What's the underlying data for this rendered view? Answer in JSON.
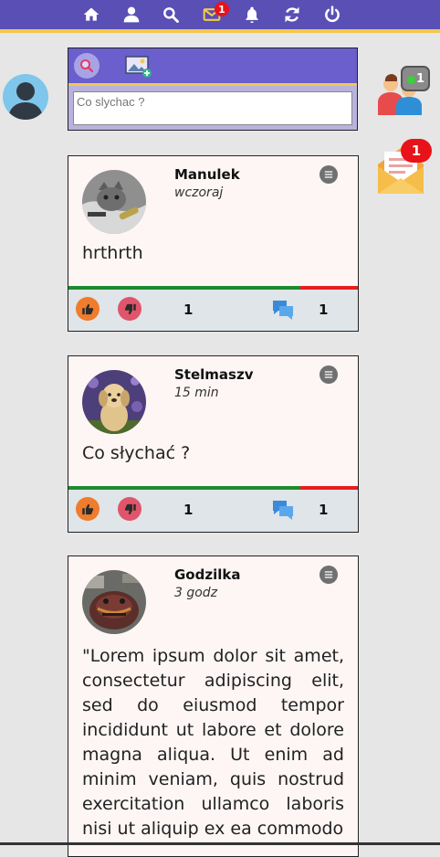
{
  "nav": {
    "message_badge": "1"
  },
  "composer": {
    "placeholder": "Co slychac ?"
  },
  "sidebar": {
    "online_users_count": "1",
    "mail_badge": "1"
  },
  "posts": [
    {
      "author": "Manulek",
      "time": "wczoraj",
      "text": "hrthrth",
      "likes": "1",
      "comments": "1",
      "approval": 0.8
    },
    {
      "author": "Stelmaszv",
      "time": "15 min",
      "text": "Co słychać ?",
      "likes": "1",
      "comments": "1",
      "approval": 0.8
    },
    {
      "author": "Godzilka",
      "time": "3 godz",
      "text": "\"Lorem ipsum dolor sit amet, consectetur adipiscing elit, sed do eiusmod tempor incididunt ut labore et dolore magna aliqua. Ut enim ad minim veniam, quis nostrud exercitation ullamco laboris nisi ut aliquip ex ea commodo"
    }
  ],
  "colors": {
    "topbar": "#5a4fb5",
    "accent": "#f2c94c",
    "like": "#f07c2c",
    "dislike": "#e0556b",
    "positive": "#1e8a2e",
    "negative": "#e51e1e",
    "badge": "#e8131a"
  }
}
